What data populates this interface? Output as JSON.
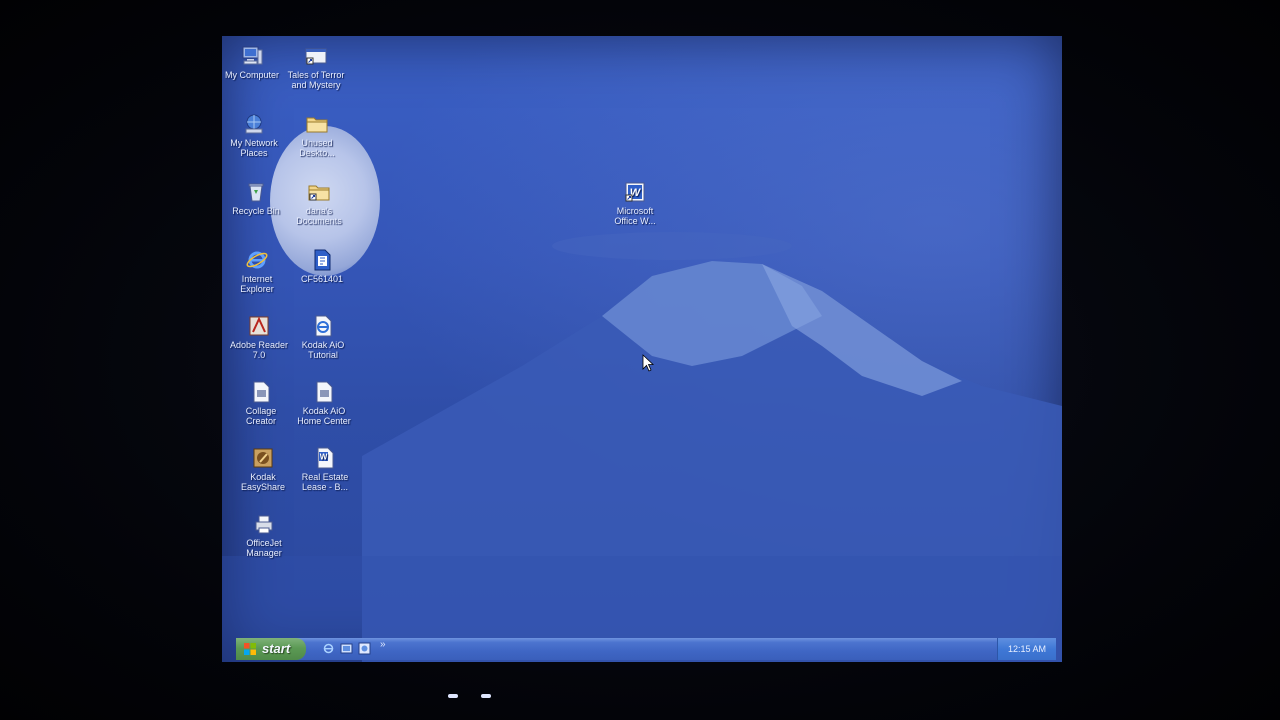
{
  "desktop": {
    "icons": [
      {
        "label": "My Computer",
        "icon": "computer-icon"
      },
      {
        "label": "Tales of Terror\nand Mystery",
        "icon": "shortcut-icon"
      },
      {
        "label": "My Network\nPlaces",
        "icon": "network-icon"
      },
      {
        "label": "Unused\nDeskto...",
        "icon": "folder-icon"
      },
      {
        "label": "Recycle Bin",
        "icon": "recycle-bin-icon"
      },
      {
        "label": "dana's\nDocuments",
        "icon": "folder-shortcut-icon"
      },
      {
        "label": "Internet\nExplorer",
        "icon": "internet-explorer-icon"
      },
      {
        "label": "CF561401",
        "icon": "document-icon"
      },
      {
        "label": "Adobe Reader\n7.0",
        "icon": "adobe-reader-icon"
      },
      {
        "label": "Kodak AiO\nTutorial",
        "icon": "kodak-tutorial-icon"
      },
      {
        "label": "Collage\nCreator",
        "icon": "collage-icon"
      },
      {
        "label": "Kodak AiO\nHome Center",
        "icon": "kodak-home-icon"
      },
      {
        "label": "Kodak\nEasyShare",
        "icon": "kodak-easyshare-icon"
      },
      {
        "label": "Real Estate\nLease - B...",
        "icon": "word-document-icon"
      },
      {
        "label": "OfficeJet\nManager",
        "icon": "printer-icon"
      },
      {
        "label": "Microsoft\nOffice W...",
        "icon": "word-icon"
      }
    ]
  },
  "taskbar": {
    "start_label": "start",
    "quick_launch": [
      "internet-explorer-icon",
      "show-desktop-icon",
      "media-icon"
    ],
    "overflow": "»",
    "clock": "12:15 AM"
  },
  "colors": {
    "wallpaper": "#3556b8",
    "taskbar": "#3f66c4",
    "start_button": "#5c9a55",
    "tray": "#3f78d6"
  }
}
